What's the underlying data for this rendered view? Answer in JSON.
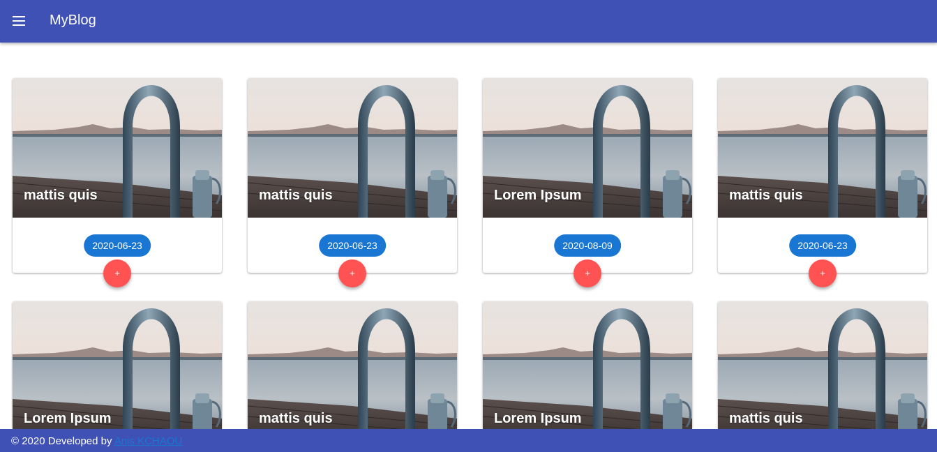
{
  "appbar": {
    "title": "MyBlog",
    "menu_icon": "menu-icon",
    "color": "#3f51b5"
  },
  "cards": [
    {
      "title": "mattis quis",
      "date": "2020-06-23",
      "action": "+"
    },
    {
      "title": "mattis quis",
      "date": "2020-06-23",
      "action": "+"
    },
    {
      "title": "Lorem Ipsum",
      "date": "2020-08-09",
      "action": "+"
    },
    {
      "title": "mattis quis",
      "date": "2020-06-23",
      "action": "+"
    },
    {
      "title": "Lorem Ipsum",
      "date": "",
      "action": ""
    },
    {
      "title": "mattis quis",
      "date": "",
      "action": ""
    },
    {
      "title": "Lorem Ipsum",
      "date": "",
      "action": ""
    },
    {
      "title": "mattis quis",
      "date": "",
      "action": ""
    }
  ],
  "colors": {
    "chip": "#1976d2",
    "fab": "#ff5252",
    "footer": "#3f51b5"
  },
  "footer": {
    "prefix": "© 2020 Developed by ",
    "author": "Anis KCHAOU"
  }
}
